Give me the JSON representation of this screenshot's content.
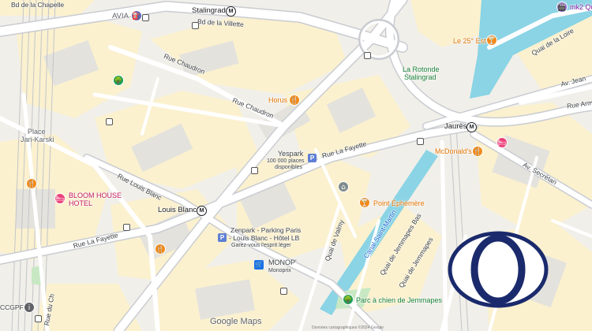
{
  "map": {
    "colors": {
      "land": "#f1efe9",
      "block": "#fbf1cf",
      "building": "#e4e2dd",
      "road": "#ffffff",
      "major_road": "#ffffff",
      "road_edge": "#c9ccd1",
      "rail": "#c3c5c9",
      "water": "#8ad4e5",
      "park": "#c7e8c3"
    },
    "streets": {
      "bd_chapelle": "Bd de la Chapelle",
      "bd_villette": "Bd de la Villette",
      "rue_chaudron_1": "Rue Chaudron",
      "rue_chaudron_2": "Rue Chaudron",
      "rue_louis_blanc": "Rue Louis Blanc",
      "rue_la_fayette_1": "Rue La Fayette",
      "rue_la_fayette_2": "Rue La Fayette",
      "quai_valmy": "Quai de Valmy",
      "quai_jemmapes_bas": "Quai de Jemmapes Bas",
      "quai_jemmapes": "Quai de Jemmapes",
      "canal": "Canal Saint-Martin",
      "quai_loire": "Quai de la Loire",
      "av_jean": "Av. Jean",
      "rue_armand": "Rue Arma",
      "av_secretan": "Av. Secrétan",
      "rue_ch": "Rue du Ch"
    },
    "places": {
      "avia": "AVIA",
      "stalingrad": "Stalingrad",
      "place_jan_1": "Place",
      "place_jan_2": "Jan-Karski",
      "rotonde_1": "La Rotonde",
      "rotonde_2": "Stalingrad",
      "le25": "Le 25° Est",
      "mk2": "mk2 Qu",
      "horus": "Horus",
      "jaures": "Jaurès",
      "mcdo": "McDonald's",
      "yespark_1": "Yespark",
      "yespark_2": "100 000 places",
      "yespark_3": "disponibles",
      "bloom_1": "BLOOM HOUSE",
      "bloom_2": "HOTEL",
      "louis_blanc": "Louis Blanc",
      "point_eph": "Point Éphémère",
      "zenpark_1": "Zenpark - Parking Paris",
      "zenpark_2": "- Louis Blanc - Hôtel LB",
      "zenpark_3": "Garez-vous l'esprit léger",
      "monop_1": "MONOP'",
      "monop_2": "Monoprix",
      "parc_jemmapes": "Parc à chien de Jemmapes",
      "ccgpf": "CCGPF"
    },
    "icons": {
      "metro": "M",
      "parking": "P",
      "restaurant": "🍴",
      "bar": "🍸",
      "hotel": "🛏",
      "park": "🌳",
      "shop": "🛒",
      "film": "🎬",
      "bus": "bus-stop-icon"
    },
    "branding": {
      "google": "Google",
      "maps": "Maps",
      "attribution": "Données cartographiques ©2024 Google"
    }
  }
}
